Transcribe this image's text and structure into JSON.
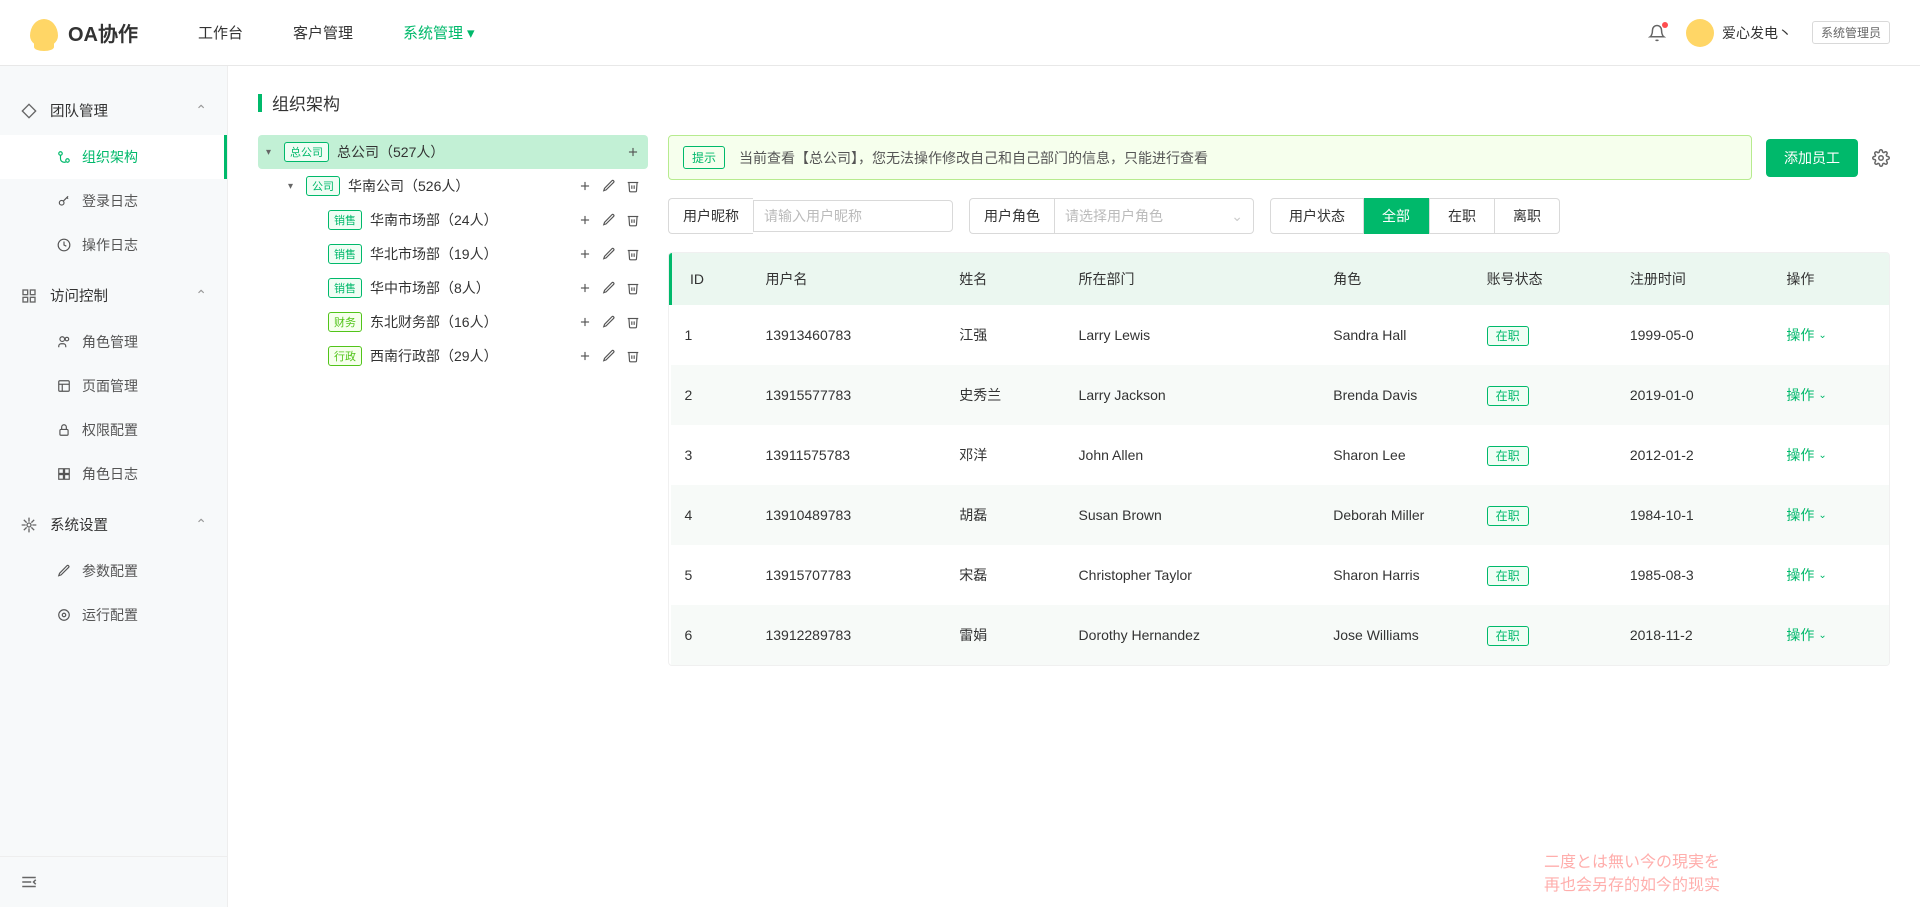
{
  "header": {
    "app_name": "OA协作",
    "nav": [
      {
        "label": "工作台",
        "active": false
      },
      {
        "label": "客户管理",
        "active": false
      },
      {
        "label": "系统管理",
        "active": true,
        "dropdown": true
      }
    ],
    "user_name": "爱心发电丶",
    "role_badge": "系统管理员"
  },
  "sidebar": {
    "sections": [
      {
        "title": "团队管理",
        "icon": "diamond",
        "items": [
          {
            "label": "组织架构",
            "icon": "branch",
            "active": true
          },
          {
            "label": "登录日志",
            "icon": "key"
          },
          {
            "label": "操作日志",
            "icon": "clock"
          }
        ]
      },
      {
        "title": "访问控制",
        "icon": "components",
        "items": [
          {
            "label": "角色管理",
            "icon": "users"
          },
          {
            "label": "页面管理",
            "icon": "pages"
          },
          {
            "label": "权限配置",
            "icon": "lock"
          },
          {
            "label": "角色日志",
            "icon": "grid"
          }
        ]
      },
      {
        "title": "系统设置",
        "icon": "gear",
        "items": [
          {
            "label": "参数配置",
            "icon": "edit"
          },
          {
            "label": "运行配置",
            "icon": "cog"
          }
        ]
      }
    ]
  },
  "page": {
    "title": "组织架构",
    "alert_tag": "提示",
    "alert_text": "当前查看【总公司】，您无法操作修改自己和自己部门的信息，只能进行查看",
    "add_button": "添加员工"
  },
  "tree": {
    "root": {
      "tag": "总公司",
      "tag_class": "tag-hq",
      "label": "总公司（527人）",
      "selected": true,
      "actions": [
        "add"
      ]
    },
    "children": [
      {
        "tag": "公司",
        "tag_class": "tag-company",
        "label": "华南公司（526人）",
        "expanded": true,
        "actions": [
          "add",
          "edit",
          "delete"
        ],
        "children": [
          {
            "tag": "销售",
            "tag_class": "tag-sales",
            "label": "华南市场部（24人）",
            "actions": [
              "add",
              "edit",
              "delete"
            ]
          },
          {
            "tag": "销售",
            "tag_class": "tag-sales",
            "label": "华北市场部（19人）",
            "actions": [
              "add",
              "edit",
              "delete"
            ]
          },
          {
            "tag": "销售",
            "tag_class": "tag-sales",
            "label": "华中市场部（8人）",
            "actions": [
              "add",
              "edit",
              "delete"
            ]
          },
          {
            "tag": "财务",
            "tag_class": "tag-finance",
            "label": "东北财务部（16人）",
            "actions": [
              "add",
              "edit",
              "delete"
            ]
          },
          {
            "tag": "行政",
            "tag_class": "tag-admin",
            "label": "西南行政部（29人）",
            "actions": [
              "add",
              "edit",
              "delete"
            ]
          }
        ]
      }
    ]
  },
  "filters": {
    "f1_label": "用户昵称",
    "f1_placeholder": "请输入用户昵称",
    "f2_label": "用户角色",
    "f2_placeholder": "请选择用户角色",
    "f3_label": "用户状态",
    "status_all": "全部",
    "status_on": "在职",
    "status_off": "离职"
  },
  "table": {
    "columns": [
      "ID",
      "用户名",
      "姓名",
      "所在部门",
      "角色",
      "账号状态",
      "注册时间",
      "操作"
    ],
    "status_text": "在职",
    "op_text": "操作",
    "rows": [
      {
        "id": "1",
        "username": "13913460783",
        "name": "江强",
        "dept": "Larry Lewis",
        "role": "Sandra Hall",
        "reg": "1999-05-0"
      },
      {
        "id": "2",
        "username": "13915577783",
        "name": "史秀兰",
        "dept": "Larry Jackson",
        "role": "Brenda Davis",
        "reg": "2019-01-0"
      },
      {
        "id": "3",
        "username": "13911575783",
        "name": "邓洋",
        "dept": "John Allen",
        "role": "Sharon Lee",
        "reg": "2012-01-2"
      },
      {
        "id": "4",
        "username": "13910489783",
        "name": "胡磊",
        "dept": "Susan Brown",
        "role": "Deborah Miller",
        "reg": "1984-10-1"
      },
      {
        "id": "5",
        "username": "13915707783",
        "name": "宋磊",
        "dept": "Christopher Taylor",
        "role": "Sharon Harris",
        "reg": "1985-08-3"
      },
      {
        "id": "6",
        "username": "13912289783",
        "name": "雷娟",
        "dept": "Dorothy Hernandez",
        "role": "Jose Williams",
        "reg": "2018-11-2"
      }
    ]
  },
  "watermark": {
    "line1": "二度とは無い今の現実を",
    "line2": "再也会另存的如今的现实"
  }
}
